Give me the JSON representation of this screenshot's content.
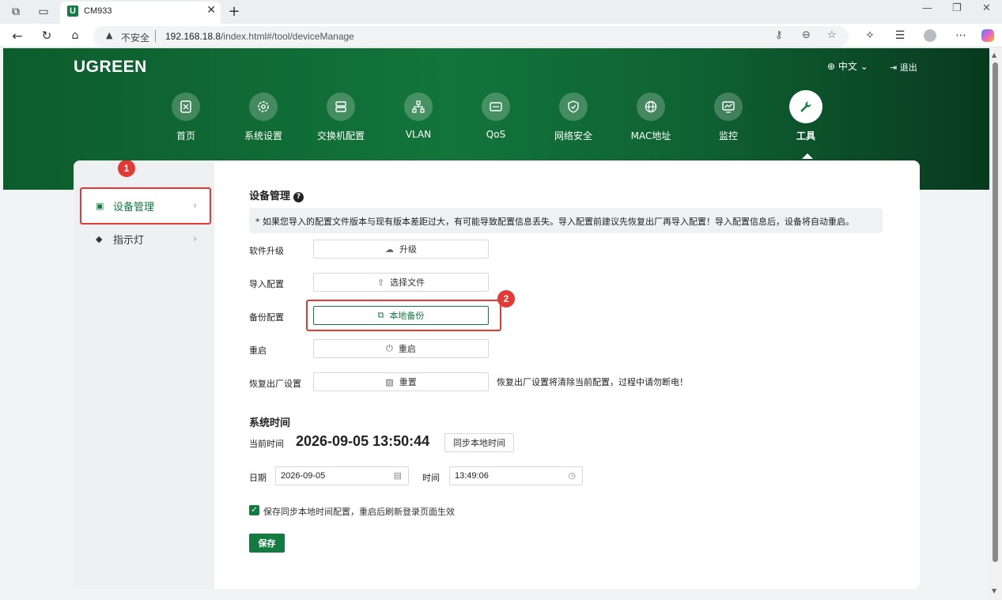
{
  "browser": {
    "tab_title": "CM933",
    "tab_favicon": "U",
    "security_label": "不安全",
    "url_host": "192.168.18.8",
    "url_path": "/index.html#/tool/deviceManage"
  },
  "header": {
    "logo": "UGREEN",
    "language": "中文",
    "logout": "退出"
  },
  "nav": {
    "items": [
      {
        "label": "首页",
        "icon": "home-icon"
      },
      {
        "label": "系统设置",
        "icon": "gear-icon"
      },
      {
        "label": "交换机配置",
        "icon": "switch-icon"
      },
      {
        "label": "VLAN",
        "icon": "network-icon"
      },
      {
        "label": "QoS",
        "icon": "qos-icon"
      },
      {
        "label": "网络安全",
        "icon": "shield-icon"
      },
      {
        "label": "MAC地址",
        "icon": "globe-icon"
      },
      {
        "label": "监控",
        "icon": "monitor-icon"
      },
      {
        "label": "工具",
        "icon": "wrench-icon",
        "active": true
      }
    ]
  },
  "sidebar": {
    "items": [
      {
        "label": "设备管理",
        "icon": "device-icon",
        "active": true
      },
      {
        "label": "指示灯",
        "icon": "diamond-icon"
      }
    ]
  },
  "annotations": {
    "badge1": "1",
    "badge2": "2"
  },
  "device": {
    "title": "设备管理",
    "notice": "* 如果您导入的配置文件版本与现有版本差距过大，有可能导致配置信息丢失。导入配置前建议先恢复出厂再导入配置！导入配置信息后，设备将自动重启。",
    "rows": [
      {
        "label": "软件升级",
        "button": "升级",
        "icon": "cloud-upload-icon"
      },
      {
        "label": "导入配置",
        "button": "选择文件",
        "icon": "upload-icon"
      },
      {
        "label": "备份配置",
        "button": "本地备份",
        "icon": "backup-icon"
      },
      {
        "label": "重启",
        "button": "重启",
        "icon": "power-icon"
      },
      {
        "label": "恢复出厂设置",
        "button": "重置",
        "icon": "reset-icon"
      }
    ],
    "factory_note": "恢复出厂设置将清除当前配置，过程中请勿断电！"
  },
  "systime": {
    "title": "系统时间",
    "now_label": "当前时间",
    "now_value": "2026-09-05 13:50:44",
    "sync_button": "同步本地时间",
    "date_label": "日期",
    "date_value": "2026-09-05",
    "time_label": "时间",
    "time_value": "13:49:06",
    "checkbox_label": "保存同步本地时间配置，重启后刷新登录页面生效",
    "checkbox_checked": true,
    "save_button": "保存"
  },
  "colors": {
    "brand": "#127b3f",
    "annotation": "#e53935"
  }
}
